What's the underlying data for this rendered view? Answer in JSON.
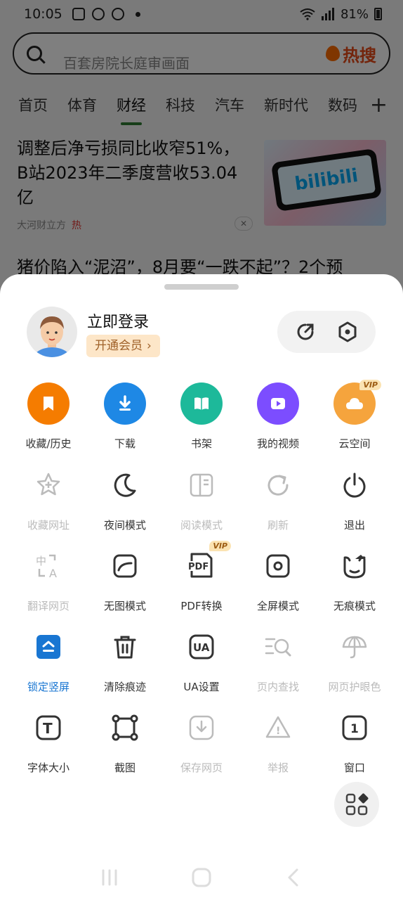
{
  "status_bar": {
    "time": "10:05",
    "battery": "81%"
  },
  "search": {
    "placeholder": "百套房院长庭审画面",
    "hot_label": "热搜"
  },
  "tabs": [
    {
      "label": "首页"
    },
    {
      "label": "体育"
    },
    {
      "label": "财经"
    },
    {
      "label": "科技"
    },
    {
      "label": "汽车"
    },
    {
      "label": "新时代"
    },
    {
      "label": "数码"
    }
  ],
  "tab_add": "+",
  "news": [
    {
      "title": "调整后净亏损同比收窄51%，B站2023年二季度营收53.04亿",
      "source": "大河财立方",
      "tag": "热",
      "image_text": "bilibili"
    },
    {
      "title": "猪价陷入“泥沼”，8月要“一跌不起”？2个预"
    }
  ],
  "account": {
    "login_label": "立即登录",
    "vip_label": "开通会员",
    "vip_chevron": "›"
  },
  "menu_rows": [
    [
      {
        "label": "收藏/历史",
        "icon": "bookmark-icon",
        "color": "#f57c00"
      },
      {
        "label": "下载",
        "icon": "download-icon",
        "color": "#1e88e5"
      },
      {
        "label": "书架",
        "icon": "book-icon",
        "color": "#1db99a"
      },
      {
        "label": "我的视频",
        "icon": "video-icon",
        "color": "#7c4dff"
      },
      {
        "label": "云空间",
        "icon": "cloud-icon",
        "color": "#f5a43d",
        "badge": "VIP"
      }
    ],
    [
      {
        "label": "收藏网址",
        "icon": "star-add-icon",
        "enabled": false
      },
      {
        "label": "夜间模式",
        "icon": "moon-icon",
        "enabled": true
      },
      {
        "label": "阅读模式",
        "icon": "reader-icon",
        "enabled": false
      },
      {
        "label": "刷新",
        "icon": "refresh-icon",
        "enabled": false
      },
      {
        "label": "退出",
        "icon": "power-icon",
        "enabled": true
      }
    ],
    [
      {
        "label": "翻译网页",
        "icon": "translate-icon",
        "enabled": false
      },
      {
        "label": "无图模式",
        "icon": "no-image-icon",
        "enabled": true
      },
      {
        "label": "PDF转换",
        "icon": "pdf-icon",
        "enabled": true,
        "badge": "VIP",
        "icon_text": "PDF"
      },
      {
        "label": "全屏模式",
        "icon": "fullscreen-icon",
        "enabled": true
      },
      {
        "label": "无痕模式",
        "icon": "incognito-icon",
        "enabled": true
      }
    ],
    [
      {
        "label": "锁定竖屏",
        "icon": "lock-portrait-icon",
        "enabled": true,
        "active": true
      },
      {
        "label": "清除痕迹",
        "icon": "trash-icon",
        "enabled": true
      },
      {
        "label": "UA设置",
        "icon": "ua-icon",
        "enabled": true,
        "icon_text": "UA"
      },
      {
        "label": "页内查找",
        "icon": "find-in-page-icon",
        "enabled": false
      },
      {
        "label": "网页护眼色",
        "icon": "umbrella-icon",
        "enabled": false
      }
    ],
    [
      {
        "label": "字体大小",
        "icon": "font-size-icon",
        "enabled": true,
        "icon_text": "T"
      },
      {
        "label": "截图",
        "icon": "screenshot-icon",
        "enabled": true
      },
      {
        "label": "保存网页",
        "icon": "save-page-icon",
        "enabled": false
      },
      {
        "label": "举报",
        "icon": "report-icon",
        "enabled": false,
        "icon_text": "!"
      },
      {
        "label": "窗口",
        "icon": "windows-icon",
        "enabled": true,
        "icon_text": "1"
      }
    ]
  ]
}
